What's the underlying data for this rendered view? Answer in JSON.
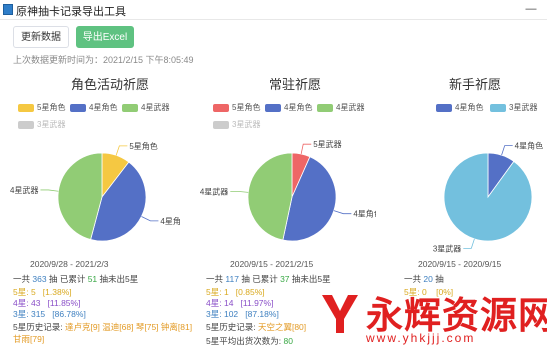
{
  "window": {
    "title": "原神抽卡记录导出工具",
    "minimize": "—"
  },
  "toolbar": {
    "refresh_label": "更新数据",
    "export_label": "导出Excel"
  },
  "last_updated": "上次数据更新时间为：2021/2/15 下午8:05:49",
  "colors": {
    "star5": "#f5c842",
    "star4_char": "#5470c6",
    "star4_weapon": "#91cc75",
    "star3": "#73c0de",
    "star5_weapon": "#ee6666",
    "disabled": "#cccccc",
    "primary_button": "#5fc281"
  },
  "pools": [
    {
      "title": "角色活动祈愿",
      "legend": [
        "5星角色",
        "4星角色",
        "4星武器",
        "3星武器"
      ],
      "date_range": "2020/9/28  -  2021/2/3",
      "summary": {
        "prefix": "一共",
        "total": "363",
        "mid": "抽 已累计",
        "pity": "51",
        "suffix": "抽未出5星"
      },
      "stats": [
        {
          "label": "5星:",
          "count": "5",
          "pct": "[1.38%]"
        },
        {
          "label": "4星:",
          "count": "43",
          "pct": "[11.85%]"
        },
        {
          "label": "3星:",
          "count": "315",
          "pct": "[86.78%]"
        }
      ],
      "history_label": "5星历史记录:",
      "history": [
        "達卢克[9]",
        "温迪[68]",
        "琴[75]",
        "钟离[81]",
        "甘雨[79]"
      ],
      "chart_data": {
        "type": "pie",
        "labels": [
          "5星角色",
          "4星角色",
          "4星武器"
        ],
        "values": [
          5,
          21,
          22
        ],
        "hidden_series": [
          "3星武器"
        ]
      }
    },
    {
      "title": "常驻祈愿",
      "legend": [
        "5星角色",
        "4星角色",
        "4星武器",
        "3星武器"
      ],
      "date_range": "2020/9/15  -  2021/2/15",
      "summary": {
        "prefix": "一共",
        "total": "117",
        "mid": "抽 已累计",
        "pity": "37",
        "suffix": "抽未出5星"
      },
      "stats": [
        {
          "label": "5星:",
          "count": "1",
          "pct": "[0.85%]"
        },
        {
          "label": "4星:",
          "count": "14",
          "pct": "[11.97%]"
        },
        {
          "label": "3星:",
          "count": "102",
          "pct": "[87.18%]"
        }
      ],
      "history_label": "5星历史记录:",
      "history": [
        "天空之翼[80]"
      ],
      "avg_label": "5星平均出货次数为:",
      "avg_value": "80",
      "chart_data": {
        "type": "pie",
        "labels": [
          "5星武器",
          "4星角色",
          "4星武器"
        ],
        "values": [
          1,
          7,
          7
        ],
        "hidden_series": [
          "3星武器"
        ]
      }
    },
    {
      "title": "新手祈愿",
      "legend": [
        "4星角色",
        "3星武器"
      ],
      "date_range": "2020/9/15  -  2020/9/15",
      "summary": {
        "prefix": "一共",
        "total": "20",
        "suffix": "抽"
      },
      "stats": [
        {
          "label": "5星:",
          "count": "0",
          "pct": "[0%]"
        }
      ],
      "chart_data": {
        "type": "pie",
        "labels": [
          "4星角色",
          "3星武器"
        ],
        "values": [
          2,
          18
        ]
      }
    }
  ],
  "watermark": {
    "text": "永辉资源网",
    "url": "www.yhkjjj.com"
  }
}
